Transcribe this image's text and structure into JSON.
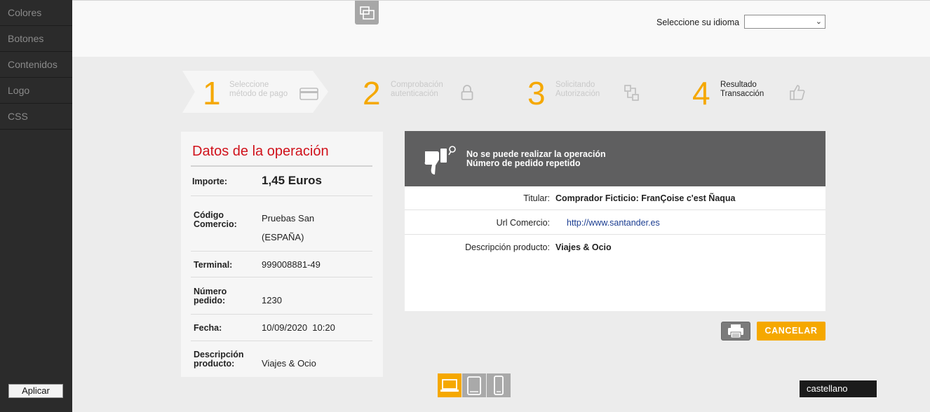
{
  "sidebar": {
    "items": [
      {
        "label": "Colores"
      },
      {
        "label": "Botones"
      },
      {
        "label": "Contenidos"
      },
      {
        "label": "Logo"
      },
      {
        "label": "CSS"
      }
    ],
    "apply_label": "Aplicar"
  },
  "header": {
    "language_label": "Seleccione su idioma",
    "language_value": ""
  },
  "steps": [
    {
      "number": "1",
      "line1": "Seleccione",
      "line2": "método de pago",
      "icon": "credit-card-icon"
    },
    {
      "number": "2",
      "line1": "Comprobación",
      "line2": "autenticación",
      "icon": "lock-icon"
    },
    {
      "number": "3",
      "line1": "Solicitando",
      "line2": "Autorización",
      "icon": "transfer-icon"
    },
    {
      "number": "4",
      "line1": "Resultado",
      "line2": "Transacción",
      "icon": "thumbs-up-icon"
    }
  ],
  "operation": {
    "title": "Datos de la operación",
    "amount_label": "Importe:",
    "amount_value": "1,45 Euros",
    "merchant_label_1": "Código",
    "merchant_label_2": "Comercio:",
    "merchant_value_1": "Pruebas San",
    "merchant_value_2": "(ESPAÑA)",
    "terminal_label": "Terminal:",
    "terminal_value": "999008881-49",
    "order_label_1": "Número",
    "order_label_2": "pedido:",
    "order_value": "1230",
    "date_label": "Fecha:",
    "date_value": "10/09/2020  10:20",
    "desc_label_1": "Descripción",
    "desc_label_2": "producto:",
    "desc_value": "Viajes & Ocio"
  },
  "result": {
    "message_1": "No se puede realizar la operación",
    "message_2": "Número de pedido repetido",
    "holder_label": "Titular:",
    "holder_value": "Comprador Ficticio: FranÇoise c'est Ñaqua",
    "url_label": "Url Comercio:",
    "url_value": "http://www.santander.es",
    "desc_label": "Descripción producto:",
    "desc_value": "Viajes & Ocio"
  },
  "actions": {
    "cancel_label": "CANCELAR"
  },
  "footer": {
    "language_tag": "castellano"
  },
  "colors": {
    "accent": "#f5a800",
    "title_red": "#d0121b",
    "banner_gray": "#5f5f60"
  }
}
